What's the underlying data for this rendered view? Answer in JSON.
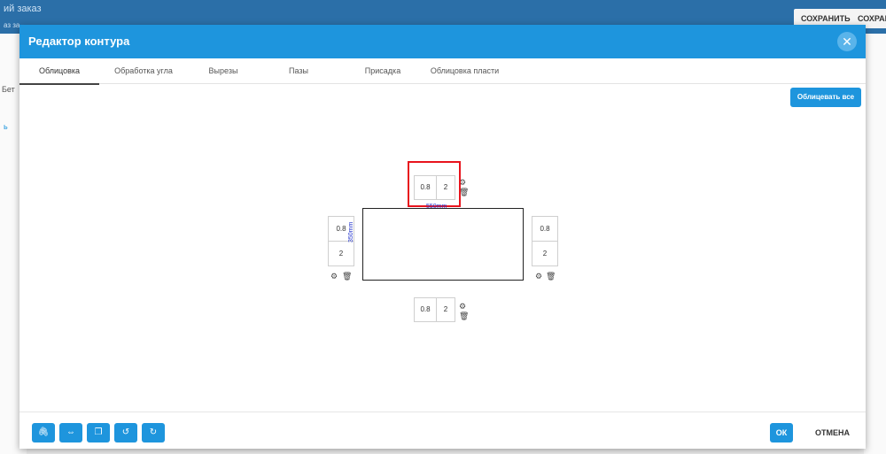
{
  "background": {
    "title": "ий заказ",
    "subtitle": "аз за",
    "save_label": "СОХРАНИТЬ",
    "save2_label": "СОХРАНИ",
    "left_frag1": "Бет",
    "left_frag2": "ь"
  },
  "dialog": {
    "title": "Редактор контура",
    "tabs": [
      "Облицовка",
      "Обработка угла",
      "Вырезы",
      "Пазы",
      "Присадка",
      "Облицовка пласти"
    ],
    "apply_all_label": "Облицевать все",
    "edges": {
      "top": {
        "thickness": "0.8",
        "width": "2"
      },
      "left": {
        "thickness": "0.8",
        "width": "2"
      },
      "right": {
        "thickness": "0.8",
        "width": "2"
      },
      "bottom": {
        "thickness": "0.8",
        "width": "2"
      }
    },
    "dimensions": {
      "width_label": "550mm",
      "height_label": "350mm"
    },
    "ok_label": "ОК",
    "cancel_label": "ОТМЕНА"
  }
}
